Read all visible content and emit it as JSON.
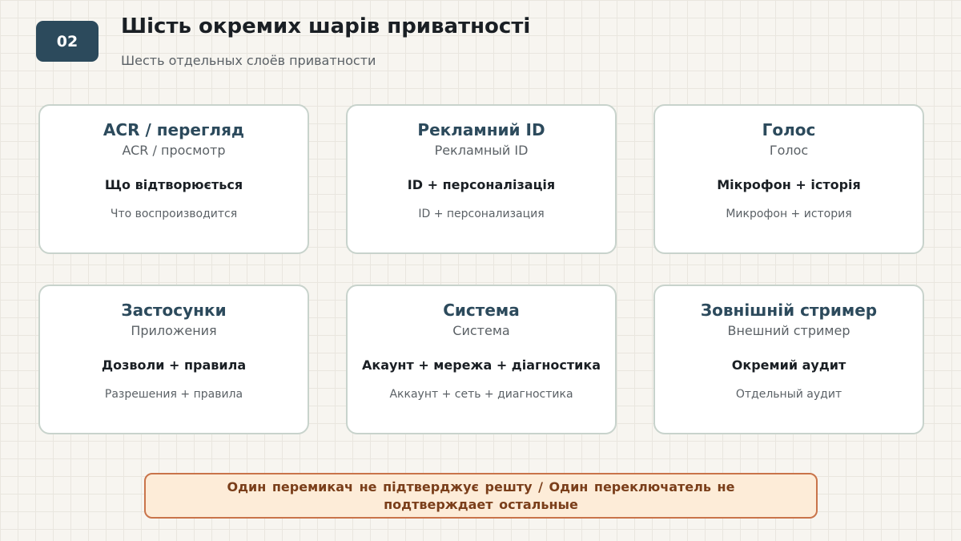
{
  "header": {
    "badge": "02",
    "title": "Шість окремих шарів приватності",
    "subtitle": "Шесть отдельных слоёв приватности"
  },
  "cards": [
    {
      "title": "ACR / перегляд",
      "subtitle": "ACR / просмотр",
      "feature": "Що відтворюється",
      "feature_ru": "Что воспроизводится"
    },
    {
      "title": "Рекламний ID",
      "subtitle": "Рекламный ID",
      "feature": "ID + персоналізація",
      "feature_ru": "ID + персонализация"
    },
    {
      "title": "Голос",
      "subtitle": "Голос",
      "feature": "Мікрофон + історія",
      "feature_ru": "Микрофон + история"
    },
    {
      "title": "Застосунки",
      "subtitle": "Приложения",
      "feature": "Дозволи + правила",
      "feature_ru": "Разрешения + правила"
    },
    {
      "title": "Система",
      "subtitle": "Система",
      "feature": "Акаунт + мережа + діагностика",
      "feature_ru": "Аккаунт + сеть + диагностика"
    },
    {
      "title": "Зовнішній стример",
      "subtitle": "Внешний стример",
      "feature": "Окремий аудит",
      "feature_ru": "Отдельный аудит"
    }
  ],
  "footer": {
    "note": "Один перемикач не підтверджує решту / Один переключатель не подтверждает остальные"
  }
}
